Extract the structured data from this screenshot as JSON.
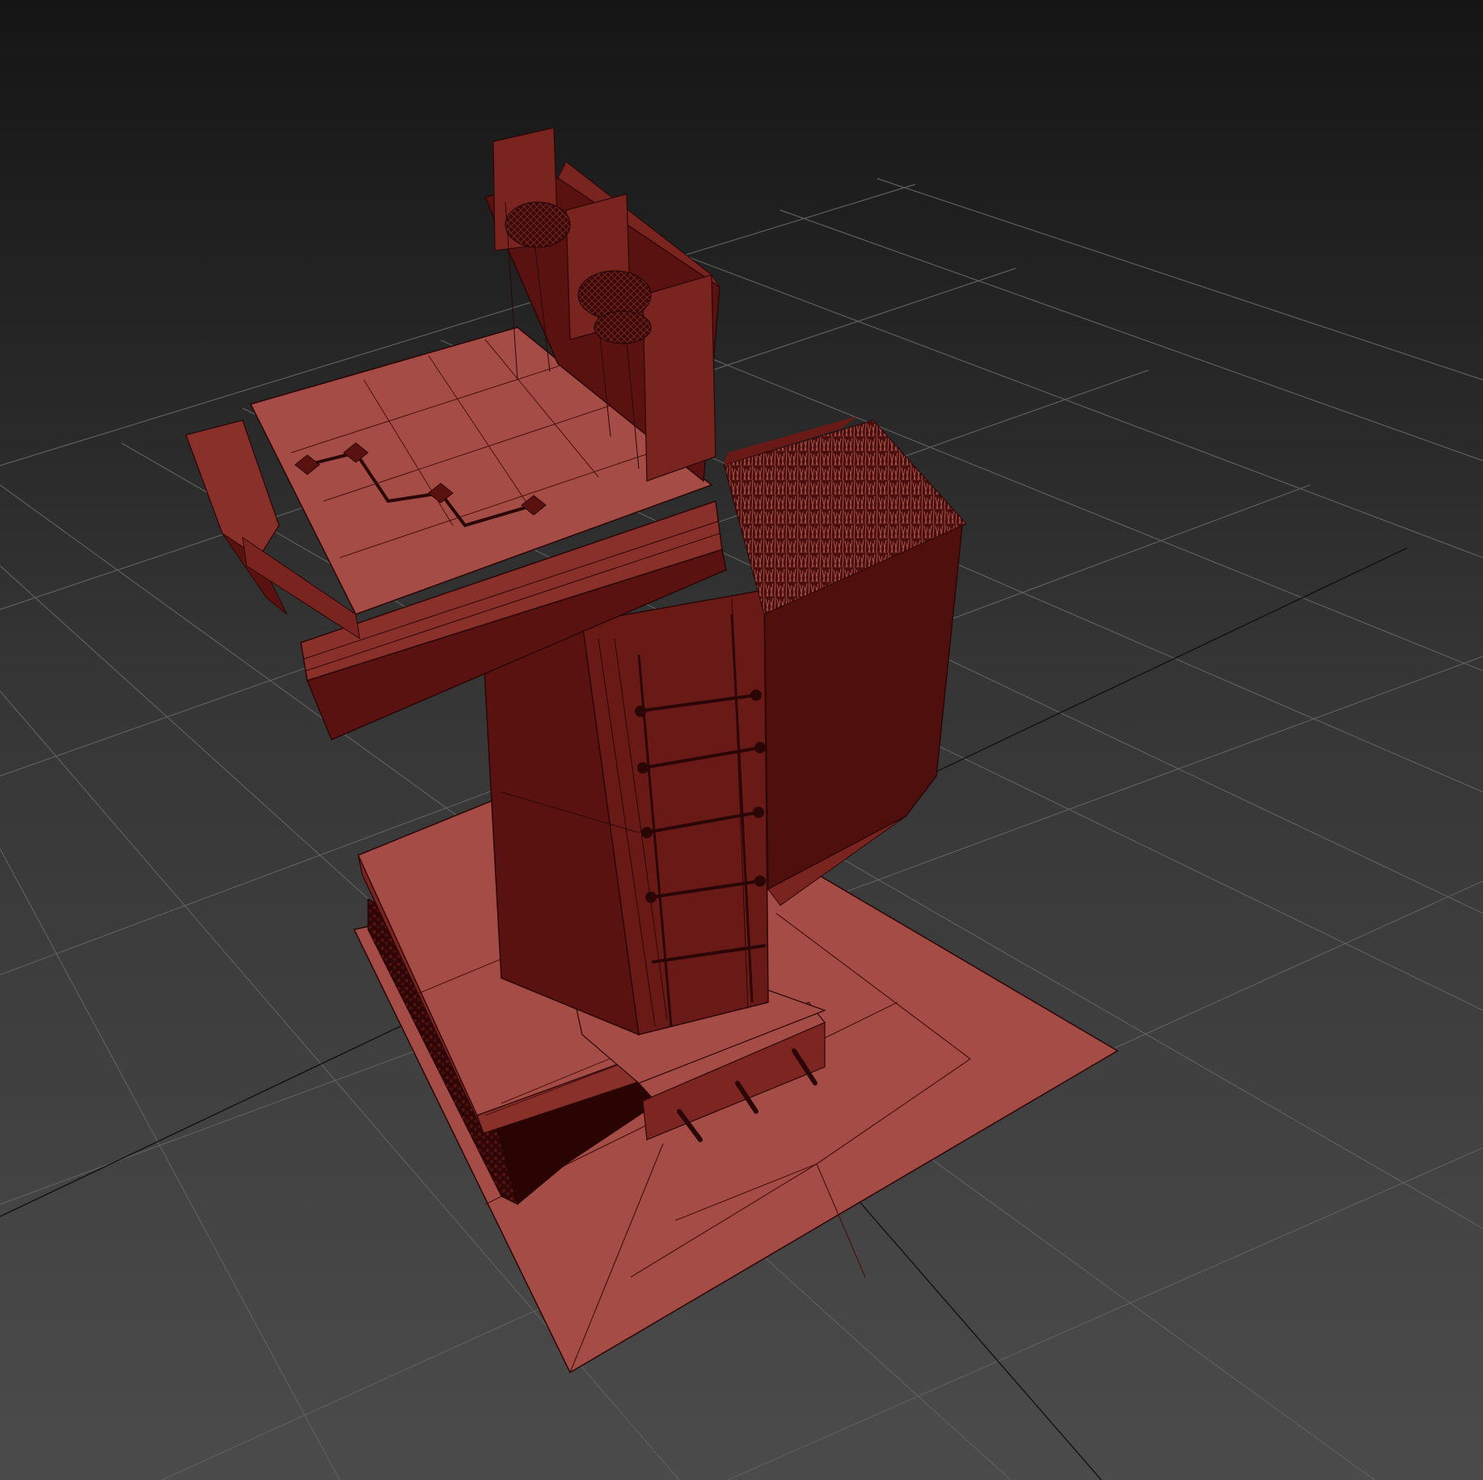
{
  "viewport": {
    "kind": "3d-perspective-viewport",
    "shading": "shaded-with-edged-faces",
    "colors": {
      "background_top": "#151515",
      "background_bottom": "#4a4a4a",
      "grid_line": "#5c5c5c",
      "grid_axis": "#111111",
      "model_lit": "#a54c46",
      "model_mid": "#7c2521",
      "model_dark": "#5a1210",
      "model_shadow": "#3f0b09",
      "wire_edge": "#2a0606"
    }
  },
  "scene": {
    "objects": [
      {
        "name": "ground-plate"
      },
      {
        "name": "lower-step-slab"
      },
      {
        "name": "main-tower-block"
      },
      {
        "name": "ladder"
      },
      {
        "name": "grass-patch"
      },
      {
        "name": "upper-platform"
      },
      {
        "name": "parapet-wall"
      },
      {
        "name": "sandbag-cluster"
      },
      {
        "name": "protruding-rebar"
      },
      {
        "name": "rubble-debris"
      }
    ]
  }
}
